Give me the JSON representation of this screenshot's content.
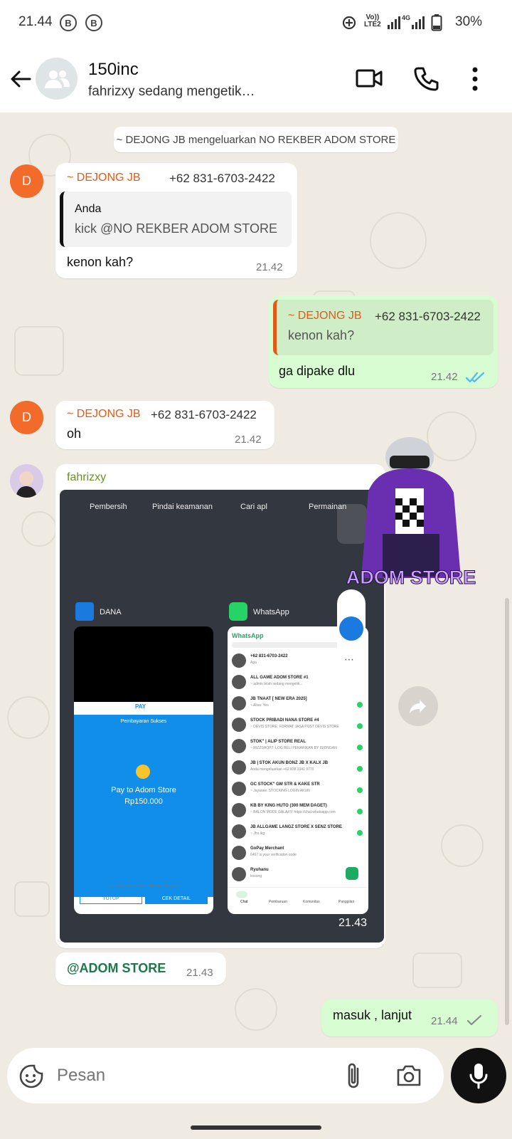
{
  "status_bar": {
    "time": "21.44",
    "indicator_1": "B",
    "indicator_2": "B",
    "network_label_1": "Vo))",
    "network_label_2": "LTE2",
    "network_label_3": "4G",
    "battery": "30%",
    "battery_level": 0.3
  },
  "header": {
    "title": "150inc",
    "subtitle": "fahrizxy sedang mengetik…",
    "back_icon": "arrow-left-icon",
    "video_icon": "video-call-icon",
    "call_icon": "phone-icon",
    "menu_icon": "more-vertical-icon"
  },
  "messages": {
    "system": "~ DEJONG JB mengeluarkan NO REKBER ADOM STORE",
    "m1": {
      "avatar": "D",
      "sender": "~ DEJONG JB",
      "phone": "+62 831-6703-2422",
      "quote_author": "Anda",
      "quote_text": "kick @NO REKBER ADOM STORE",
      "text": "kenon kah?",
      "time": "21.42"
    },
    "m2": {
      "quote_author": "~ DEJONG JB",
      "quote_phone": "+62 831-6703-2422",
      "quote_text": "kenon kah?",
      "text": "ga dipake dlu",
      "time": "21.42",
      "status": "read"
    },
    "m3": {
      "avatar": "D",
      "sender": "~ DEJONG JB",
      "phone": "+62 831-6703-2422",
      "text": "oh",
      "time": "21.42"
    },
    "m4": {
      "sender": "fahrizxy",
      "time": "21.43",
      "image": {
        "top_labels": [
          "Pembersih",
          "Pindai keamanan",
          "Cari apl",
          "Permainan"
        ],
        "app1": "DANA",
        "app2": "WhatsApp",
        "dana_badge": "PAY",
        "dana_status": "Pembayaran Sukses",
        "dana_pay_to": "Pay to Adom Store",
        "dana_amount": "Rp150.000",
        "dana_note": "Kamu bisa cek detailnya di Riwayat Transaksi",
        "dana_btn1": "TUTUP",
        "dana_btn2": "CEK DETAIL",
        "wa_title": "WhatsApp",
        "wa_chats": [
          {
            "name": "+62 831-6703-2422",
            "snippet": "Apa"
          },
          {
            "name": "ALL GAME ADOM STORE #1",
            "snippet": "~ admin lelah sedang mengetik..."
          },
          {
            "name": "JB TNAAT [ NEW ERA 2025]",
            "snippet": "~ Alisa: Yes"
          },
          {
            "name": "STOCK PRIBADI NANA STORE #4",
            "snippet": "~ DEVIS STORE: FORMAT JASA POST DEVIS STORE"
          },
          {
            "name": "STOK\" | ALIP STORE REAL",
            "snippet": "~ RIZZSHOP7: LOG BELI PENARIKAN BY ISIDNGAN"
          },
          {
            "name": "JB | STOK AKUN BONZ JB X KALX JB",
            "snippet": "Anda mengeluarkan +62 838 3341 9770"
          },
          {
            "name": "GC STOCK\" GM STR & KAKE STR",
            "snippet": "~ Jayaraw: STOCKING LOGIN AKUN"
          },
          {
            "name": "KB BY KING HUTO (300 MEM DAGET)",
            "snippet": "~ BALON MODE GALAXY: https://chat.whatsapp.com"
          },
          {
            "name": "JB ALLGAME LANGZ STORE X SENZ STORE",
            "snippet": "~ Jho ikg"
          },
          {
            "name": "GoPay Merchant",
            "snippet": "6467 is your verification code"
          },
          {
            "name": "Ryuhanu",
            "snippet": "kosong"
          }
        ],
        "wa_tabs": [
          "Chat",
          "Pembaruan",
          "Komunitas",
          "Panggilan"
        ],
        "sticker_text": "ADOM STORE"
      }
    },
    "m5": {
      "text": "@ADOM STORE",
      "time": "21.43"
    },
    "m6": {
      "text": "masuk , lanjut",
      "time": "21.44",
      "status": "delivered"
    }
  },
  "input": {
    "placeholder": "Pesan",
    "emoji_icon": "sticker-icon",
    "attach_icon": "paperclip-icon",
    "camera_icon": "camera-icon",
    "mic_icon": "microphone-icon"
  },
  "colors": {
    "outgoing": "#d9fdd3",
    "sender_orange": "#e05a1a",
    "sender_green": "#6b8e23",
    "read_tick": "#53bdeb",
    "wallpaper": "#efeae2"
  }
}
